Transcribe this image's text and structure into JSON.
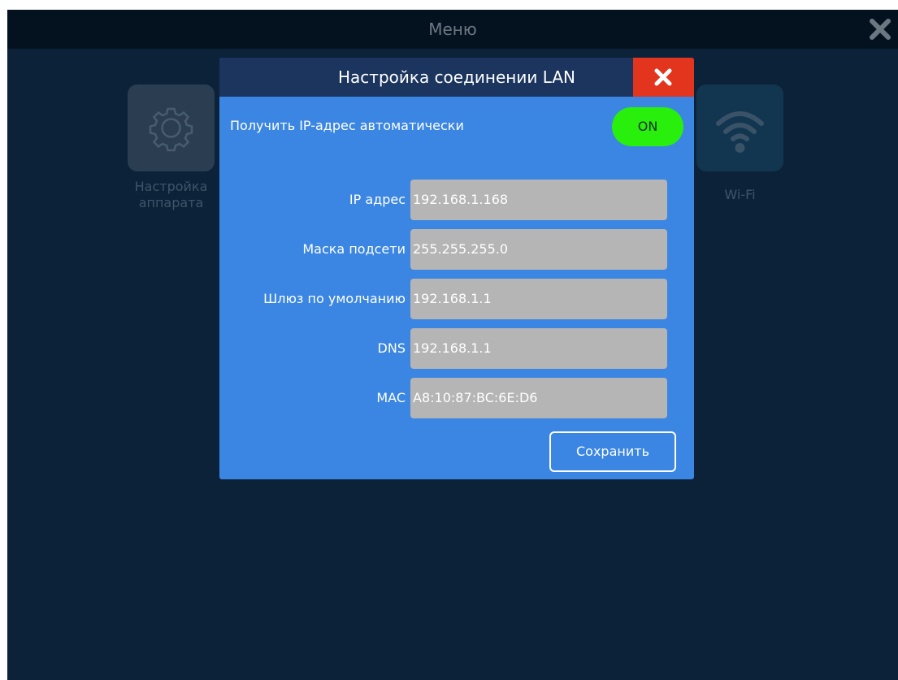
{
  "app": {
    "menu_title": "Меню",
    "close_icon": "close-icon"
  },
  "menu_tiles": [
    {
      "label": "Настройка аппарата",
      "icon": "gear-icon"
    },
    {
      "label": "Wi-Fi",
      "icon": "wifi-icon"
    }
  ],
  "dialog": {
    "title": "Настройка соединении LAN",
    "close_icon": "close-icon",
    "close_color": "#e3341d",
    "dhcp": {
      "label": "Получить IP-адрес автоматически",
      "toggle_label": "ON",
      "toggle_color": "#28f00c"
    },
    "fields": [
      {
        "label": "IP адрес",
        "value": "192.168.1.168"
      },
      {
        "label": "Маска подсети",
        "value": "255.255.255.0"
      },
      {
        "label": "Шлюз по умолчанию",
        "value": "192.168.1.1"
      },
      {
        "label": "DNS",
        "value": "192.168.1.1"
      },
      {
        "label": "MAC",
        "value": "A8:10:87:BC:6E:D6"
      }
    ],
    "save_label": "Сохранить"
  },
  "colors": {
    "background": "#0b2239",
    "topbar": "#04121f",
    "dialog_body": "#3a86e2",
    "dialog_header": "#1b355e",
    "field_bg": "#b5b5b5"
  }
}
